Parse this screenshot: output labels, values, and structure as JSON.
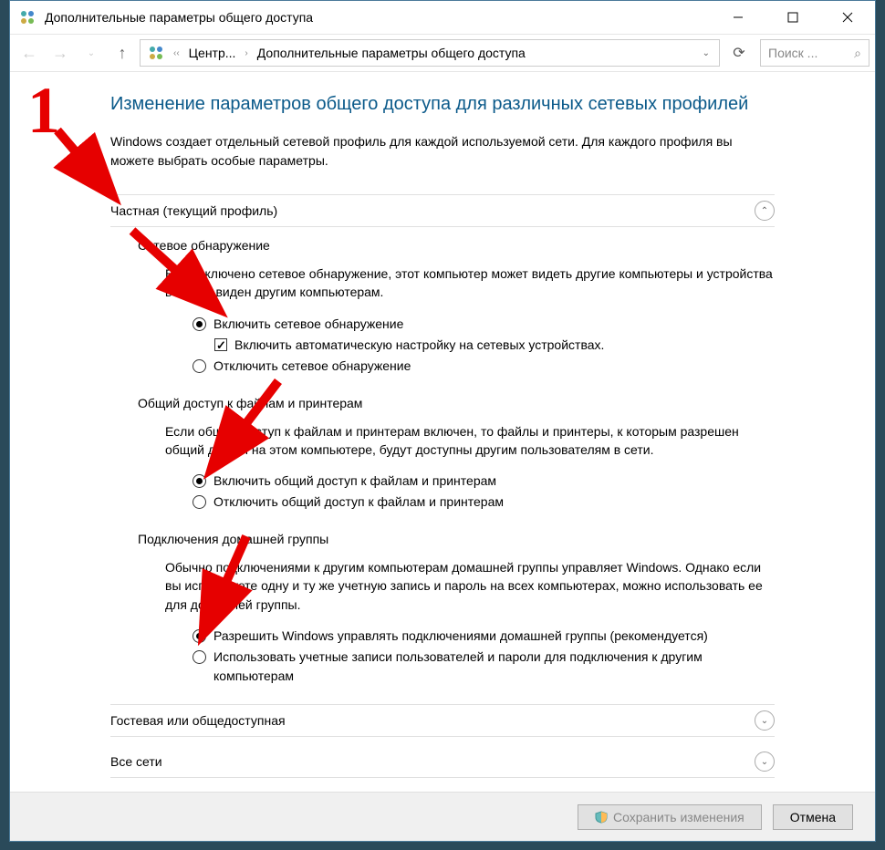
{
  "window": {
    "title": "Дополнительные параметры общего доступа"
  },
  "breadcrumb": {
    "item1": "Центр...",
    "item2": "Дополнительные параметры общего доступа"
  },
  "search": {
    "placeholder": "Поиск ..."
  },
  "heading": "Изменение параметров общего доступа для различных сетевых профилей",
  "intro": "Windows создает отдельный сетевой профиль для каждой используемой сети. Для каждого профиля вы можете выбрать особые параметры.",
  "section_private": "Частная (текущий профиль)",
  "discovery": {
    "title": "Сетевое обнаружение",
    "desc": "Если включено сетевое обнаружение, этот компьютер может видеть другие компьютеры и устройства в сети и виден другим компьютерам.",
    "opt_on": "Включить сетевое обнаружение",
    "opt_auto": "Включить автоматическую настройку на сетевых устройствах.",
    "opt_off": "Отключить сетевое обнаружение"
  },
  "fileshare": {
    "title": "Общий доступ к файлам и принтерам",
    "desc": "Если общий доступ к файлам и принтерам включен, то файлы и принтеры, к которым разрешен общий доступ на этом компьютере, будут доступны другим пользователям в сети.",
    "opt_on": "Включить общий доступ к файлам и принтерам",
    "opt_off": "Отключить общий доступ к файлам и принтерам"
  },
  "homegroup": {
    "title": "Подключения домашней группы",
    "desc": "Обычно подключениями к другим компьютерам домашней группы управляет Windows. Однако если вы используете одну и ту же учетную запись и пароль на всех компьютерах, можно использовать ее для домашней группы.",
    "opt_allow": "Разрешить Windows управлять подключениями домашней группы (рекомендуется)",
    "opt_user": "Использовать учетные записи пользователей и пароли для подключения к другим компьютерам"
  },
  "section_guest": "Гостевая или общедоступная",
  "section_all": "Все сети",
  "buttons": {
    "save": "Сохранить изменения",
    "cancel": "Отмена"
  },
  "annotation": {
    "number": "1"
  }
}
